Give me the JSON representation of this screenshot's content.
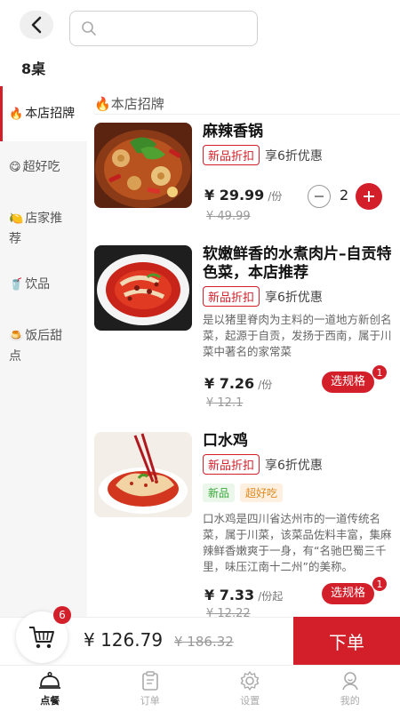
{
  "header": {
    "search_placeholder": "",
    "table_label": "8桌"
  },
  "sidebar": {
    "items": [
      {
        "icon": "fire-icon",
        "emoji": "🔥",
        "label": "本店招牌",
        "active": true
      },
      {
        "icon": "smile-icon",
        "emoji": "😋",
        "label": "超好吃",
        "active": false
      },
      {
        "icon": "lemon-icon",
        "emoji": "🍋",
        "label": "店家推荐",
        "active": false
      },
      {
        "icon": "drink-icon",
        "emoji": "🥤",
        "label": "饮品",
        "active": false
      },
      {
        "icon": "dessert-icon",
        "emoji": "🍮",
        "label": "饭后甜点",
        "active": false
      }
    ]
  },
  "section": {
    "emoji": "🔥",
    "title": "本店招牌"
  },
  "products": [
    {
      "name": "麻辣香锅",
      "promo_tag": "新品折扣",
      "promo_text": "享6折优惠",
      "price": "¥ 29.99",
      "unit": "/份",
      "old_price": "¥ 49.99",
      "quantity": "2"
    },
    {
      "name": "软嫩鲜香的水煮肉片–自贡特色菜，本店推荐",
      "promo_tag": "新品折扣",
      "promo_text": "享6折优惠",
      "desc": "是以猪里脊肉为主料的一道地方新创名菜，起源于自贡，发扬于西南，属于川菜中著名的家常菜",
      "price": "¥ 7.26",
      "unit": "/份",
      "old_price": "¥ 12.1",
      "spec_label": "选规格",
      "badge": "1"
    },
    {
      "name": "口水鸡",
      "promo_tag": "新品折扣",
      "promo_text": "享6折优惠",
      "tags": [
        "新品",
        "超好吃"
      ],
      "desc": "口水鸡是四川省达州市的一道传统名菜，属于川菜，该菜品佐料丰富，集麻辣鲜香嫩爽于一身，有“名驰巴蜀三千里，味压江南十二州”的美称。",
      "price": "¥ 7.33",
      "unit": "/份起",
      "old_price": "¥ 12.22",
      "spec_label": "选规格",
      "badge": "1"
    }
  ],
  "cart": {
    "count": "6",
    "total": "¥ 126.79",
    "original_total": "¥ 186.32",
    "order_label": "下单"
  },
  "tabbar": [
    {
      "label": "点餐",
      "icon": "dining-icon",
      "active": true
    },
    {
      "label": "订单",
      "icon": "clipboard-icon",
      "active": false
    },
    {
      "label": "设置",
      "icon": "gear-icon",
      "active": false
    },
    {
      "label": "我的",
      "icon": "user-icon",
      "active": false
    }
  ],
  "colors": {
    "accent": "#d21f2a",
    "green": "#3aa93a",
    "orange": "#e08a20"
  }
}
